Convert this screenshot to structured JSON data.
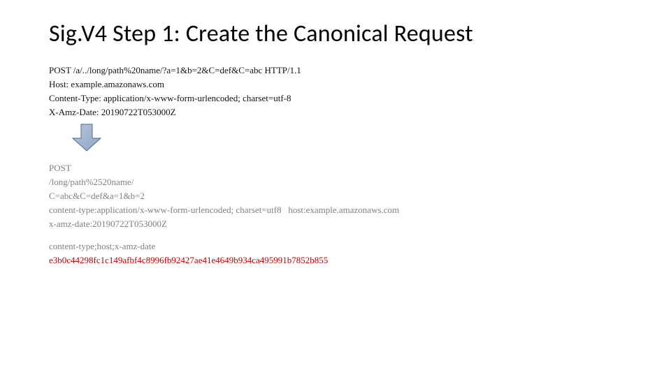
{
  "title": "Sig.V4 Step 1: Create the Canonical Request",
  "raw": {
    "l1": "POST /a/../long/path%20name/?a=1&b=2&C=def&C=abc HTTP/1.1",
    "l2": "Host: example.amazonaws.com",
    "l3": "Content-Type: application/x-www-form-urlencoded; charset=utf-8",
    "l4": "X-Amz-Date: 20190722T053000Z"
  },
  "canon": {
    "method": "POST",
    "path": "/long/path%2520name/",
    "query": "C=abc&C=def&a=1&b=2",
    "headers_line": "content-type:application/x-www-form-urlencoded; charset=utf8   host:example.amazonaws.com",
    "date_line": "x-amz-date:20190722T053000Z",
    "signed_headers": "content-type;host;x-amz-date",
    "hash": "e3b0c44298fc1c149afbf4c8996fb92427ae41e4649b934ca495991b7852b855"
  }
}
